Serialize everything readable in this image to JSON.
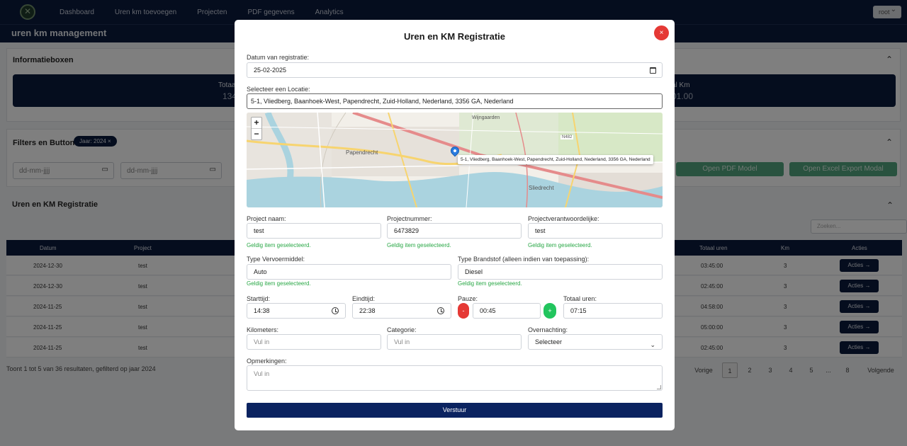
{
  "nav": {
    "items": [
      "Dashboard",
      "Uren km toevoegen",
      "Projecten",
      "PDF gegevens",
      "Analytics"
    ],
    "user": "root"
  },
  "subheader": {
    "title": "uren km management"
  },
  "sections": {
    "info": {
      "title": "Informatieboxen",
      "left_label": "Totaal",
      "left_value": "134",
      "right_label": "al Km",
      "right_value": "01.00"
    },
    "filters": {
      "title": "Filters en Buttons",
      "badge": "Jaar: 2024  ×",
      "date_placeholder": "dd-mm-jjjj",
      "pdf_btn": "Open PDF Model",
      "excel_btn": "Open Excel Export Modal"
    },
    "table": {
      "title": "Uren en KM Registratie",
      "search_placeholder": "Zoeken...",
      "headers": [
        "Datum",
        "Project",
        "Totaal uren",
        "Km",
        "Acties"
      ],
      "rows": [
        {
          "datum": "2024-12-30",
          "project": "test",
          "uren": "03:45:00",
          "km": "3"
        },
        {
          "datum": "2024-12-30",
          "project": "test",
          "uren": "02:45:00",
          "km": "3"
        },
        {
          "datum": "2024-11-25",
          "project": "test",
          "uren": "04:58:00",
          "km": "3"
        },
        {
          "datum": "2024-11-25",
          "project": "test",
          "uren": "05:00:00",
          "km": "3"
        },
        {
          "datum": "2024-11-25",
          "project": "test",
          "uren": "02:45:00",
          "km": "3"
        }
      ],
      "acties_label": "Acties",
      "results_info": "Toont 1 tot 5 van 36 resultaten, gefilterd op jaar 2024",
      "pager": {
        "prev": "Vorige",
        "pages": [
          "1",
          "2",
          "3",
          "4",
          "5",
          "...",
          "8"
        ],
        "next": "Volgende"
      }
    }
  },
  "modal": {
    "title": "Uren en KM Registratie",
    "close": "×",
    "date_label": "Datum van registratie:",
    "date_value": "25-02-2025",
    "location_label": "Selecteer een Locatie:",
    "location_value": "5-1, Vliedberg, Baanhoek-West, Papendrecht, Zuid-Holland, Nederland, 3356 GA, Nederland",
    "map": {
      "popup": "5-1, Vliedberg, Baanhoek-West, Papendrecht, Zuid-Holland, Nederland, 3356 GA, Nederland",
      "labels": [
        "Wijngaarden",
        "Papendrecht",
        "Sliedrecht",
        "N482"
      ],
      "zoom_in": "+",
      "zoom_out": "−"
    },
    "project_name_label": "Project naam:",
    "project_name_value": "test",
    "project_number_label": "Projectnummer:",
    "project_number_value": "6473829",
    "project_owner_label": "Projectverantwoordelijke:",
    "project_owner_value": "test",
    "valid_text": "Geldig item geselecteerd.",
    "transport_label": "Type Vervoermiddel:",
    "transport_value": "Auto",
    "fuel_label": "Type Brandstof (alleen indien van toepassing):",
    "fuel_value": "Diesel",
    "start_label": "Starttijd:",
    "start_value": "14:38",
    "end_label": "Eindtijd:",
    "end_value": "22:38",
    "pause_label": "Pauze:",
    "pause_value": "00:45",
    "minus": "-",
    "plus": "+",
    "total_label": "Totaal uren:",
    "total_value": "07:15",
    "km_label": "Kilometers:",
    "km_placeholder": "Vul in",
    "category_label": "Categorie:",
    "category_placeholder": "Vul in",
    "overnight_label": "Overnachting:",
    "overnight_value": "Selecteer",
    "remarks_label": "Opmerkingen:",
    "remarks_placeholder": "Vul in",
    "submit": "Verstuur"
  }
}
